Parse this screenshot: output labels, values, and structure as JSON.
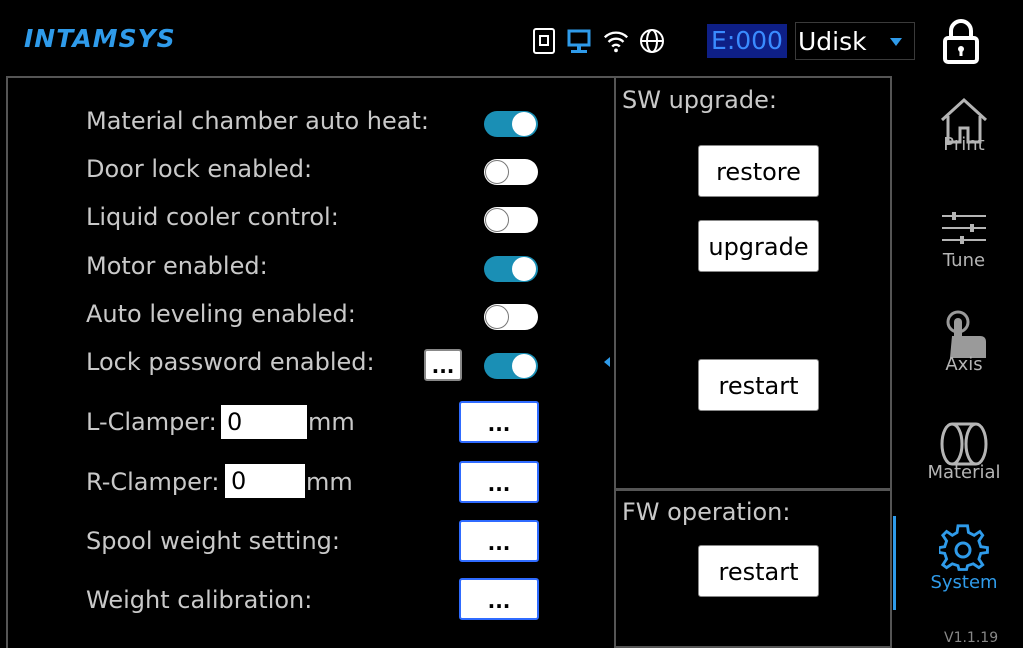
{
  "header": {
    "logo": "INTAMSYS",
    "error_code": "E:000",
    "storage": {
      "selected": "Udisk"
    },
    "icons": [
      "sd-card-icon",
      "network-icon",
      "wifi-icon",
      "globe-icon",
      "lock-icon"
    ]
  },
  "settings": {
    "material_chamber_auto_heat": {
      "label": "Material chamber auto heat:",
      "enabled": true
    },
    "door_lock_enabled": {
      "label": "Door lock enabled:",
      "enabled": false
    },
    "liquid_cooler_control": {
      "label": "Liquid cooler control:",
      "enabled": false
    },
    "motor_enabled": {
      "label": "Motor enabled:",
      "enabled": true
    },
    "auto_leveling_enabled": {
      "label": "Auto leveling enabled:",
      "enabled": false
    },
    "lock_password_enabled": {
      "label": "Lock password enabled:",
      "enabled": true,
      "button": "..."
    },
    "l_clamper": {
      "label": "L-Clamper:",
      "value": "0",
      "unit": "mm",
      "button": "..."
    },
    "r_clamper": {
      "label": "R-Clamper:",
      "value": "0",
      "unit": "mm",
      "button": "..."
    },
    "spool_weight_setting": {
      "label": "Spool weight setting:",
      "button": "..."
    },
    "weight_calibration": {
      "label": "Weight calibration:",
      "button": "..."
    }
  },
  "sw_upgrade": {
    "title": "SW upgrade:",
    "restore": "restore",
    "upgrade": "upgrade",
    "restart": "restart"
  },
  "fw_operation": {
    "title": "FW operation:",
    "restart": "restart"
  },
  "sidebar": {
    "items": [
      {
        "label": "Print",
        "icon": "home-icon"
      },
      {
        "label": "Tune",
        "icon": "sliders-icon"
      },
      {
        "label": "Axis",
        "icon": "hand-icon"
      },
      {
        "label": "Material",
        "icon": "spool-icon"
      },
      {
        "label": "System",
        "icon": "gear-icon",
        "active": true
      }
    ],
    "version": "V1.1.19"
  },
  "colors": {
    "accent": "#2f9bea",
    "toggle_on": "#1a8fb5",
    "error_bg": "#0e1f86"
  }
}
